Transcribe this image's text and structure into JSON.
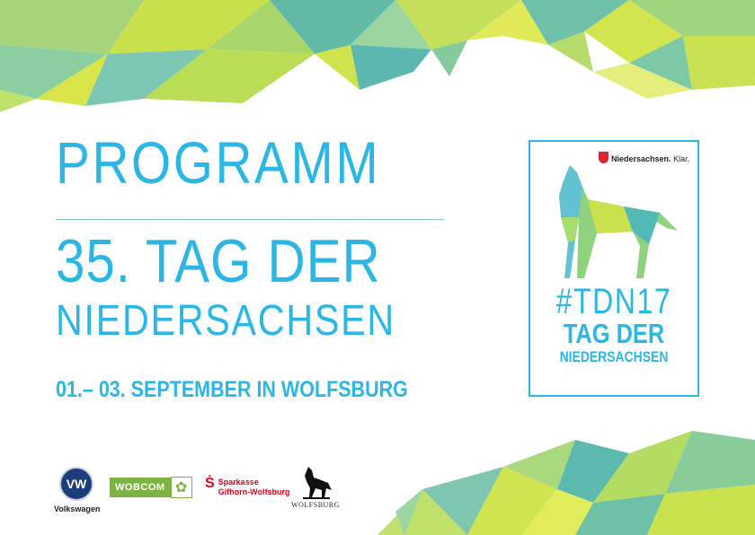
{
  "document": {
    "title": "PROGRAMM",
    "headline_line1": "35. TAG DER",
    "headline_line2": "NIEDERSACHSEN",
    "date_location": "01.– 03. SEPTEMBER IN WOLFSBURG"
  },
  "badge": {
    "brand_name": "Niedersachsen.",
    "brand_claim": "Klar.",
    "hashtag": "#TDN17",
    "event_line1": "TAG DER",
    "event_line2": "NIEDERSACHSEN"
  },
  "sponsors": [
    {
      "name": "Volkswagen"
    },
    {
      "name": "WOBCOM"
    },
    {
      "name_line1": "Sparkasse",
      "name_line2": "Gifhorn-Wolfsburg"
    },
    {
      "name": "WOLFSBURG"
    }
  ],
  "colors": {
    "primary_blue": "#2bb6e6",
    "lime": "#c6dd3a",
    "teal": "#4fb8a8",
    "sparkasse_red": "#e2001a",
    "wobcom_green": "#7cb342"
  },
  "icons": {
    "volkswagen": "vw-logo-icon",
    "wobcom": "wobcom-logo-icon",
    "sparkasse": "sparkasse-logo-icon",
    "wolfsburg": "howling-wolf-icon",
    "niedersachsen": "lower-saxony-crest-icon"
  }
}
